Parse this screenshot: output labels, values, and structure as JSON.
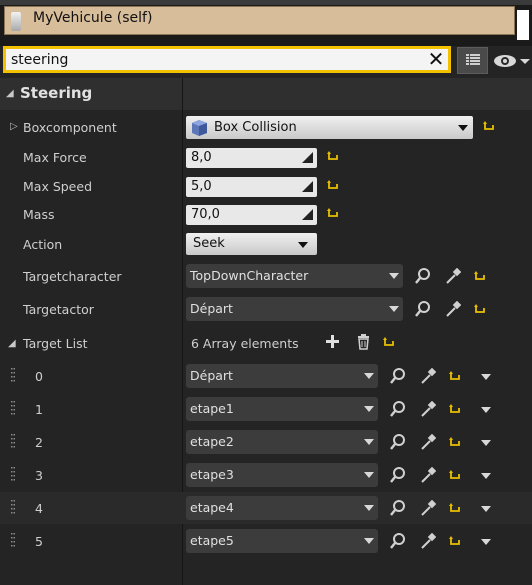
{
  "component": {
    "label": "MyVehicule (self)"
  },
  "search": {
    "value": "steering",
    "clear_glyph": "✕"
  },
  "category": {
    "title": "Steering"
  },
  "properties": {
    "boxcomponent": {
      "label": "Boxcomponent",
      "value": "Box Collision"
    },
    "max_force": {
      "label": "Max Force",
      "value": "8,0"
    },
    "max_speed": {
      "label": "Max Speed",
      "value": "5,0"
    },
    "mass": {
      "label": "Mass",
      "value": "70,0"
    },
    "action": {
      "label": "Action",
      "value": "Seek"
    },
    "targetcharacter": {
      "label": "Targetcharacter",
      "value": "TopDownCharacter"
    },
    "targetactor": {
      "label": "Targetactor",
      "value": "Départ"
    },
    "target_list": {
      "label": "Target List",
      "summary": "6 Array elements",
      "items": [
        {
          "index": "0",
          "value": "Départ"
        },
        {
          "index": "1",
          "value": "etape1"
        },
        {
          "index": "2",
          "value": "etape2"
        },
        {
          "index": "3",
          "value": "etape3"
        },
        {
          "index": "4",
          "value": "etape4"
        },
        {
          "index": "5",
          "value": "etape5"
        }
      ]
    }
  },
  "colors": {
    "accent_search": "#f2c200",
    "reset_arrow": "#e8c000",
    "component_bg": "#d7bd9a",
    "panel_bg": "#242424"
  }
}
